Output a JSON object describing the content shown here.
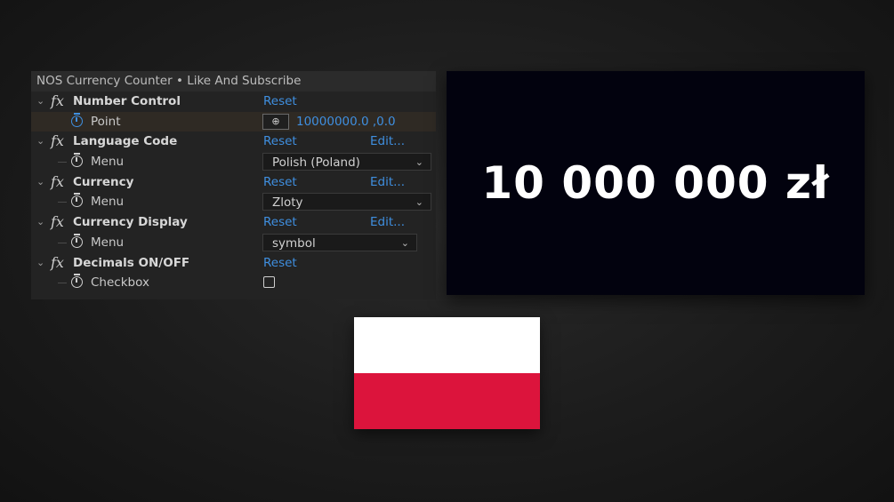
{
  "panel": {
    "title": "NOS Currency Counter • Like And Subscribe",
    "effects": [
      {
        "name": "Number Control",
        "reset": "Reset",
        "edit": "",
        "param": {
          "label": "Point",
          "value": "10000000.0 ,0.0",
          "icon": "point-target-icon"
        }
      },
      {
        "name": "Language Code",
        "reset": "Reset",
        "edit": "Edit...",
        "param": {
          "label": "Menu",
          "value": "Polish (Poland)"
        }
      },
      {
        "name": "Currency",
        "reset": "Reset",
        "edit": "Edit...",
        "param": {
          "label": "Menu",
          "value": "Zloty"
        }
      },
      {
        "name": "Currency Display",
        "reset": "Reset",
        "edit": "Edit...",
        "param": {
          "label": "Menu",
          "value": "symbol"
        }
      },
      {
        "name": "Decimals ON/OFF",
        "reset": "Reset",
        "edit": "",
        "param": {
          "label": "Checkbox",
          "checked": false
        }
      }
    ]
  },
  "preview": {
    "text": "10 000 000 zł",
    "background": "#02020e"
  },
  "flag": {
    "name": "Poland",
    "top_color": "#ffffff",
    "bottom_color": "#dc143c"
  }
}
